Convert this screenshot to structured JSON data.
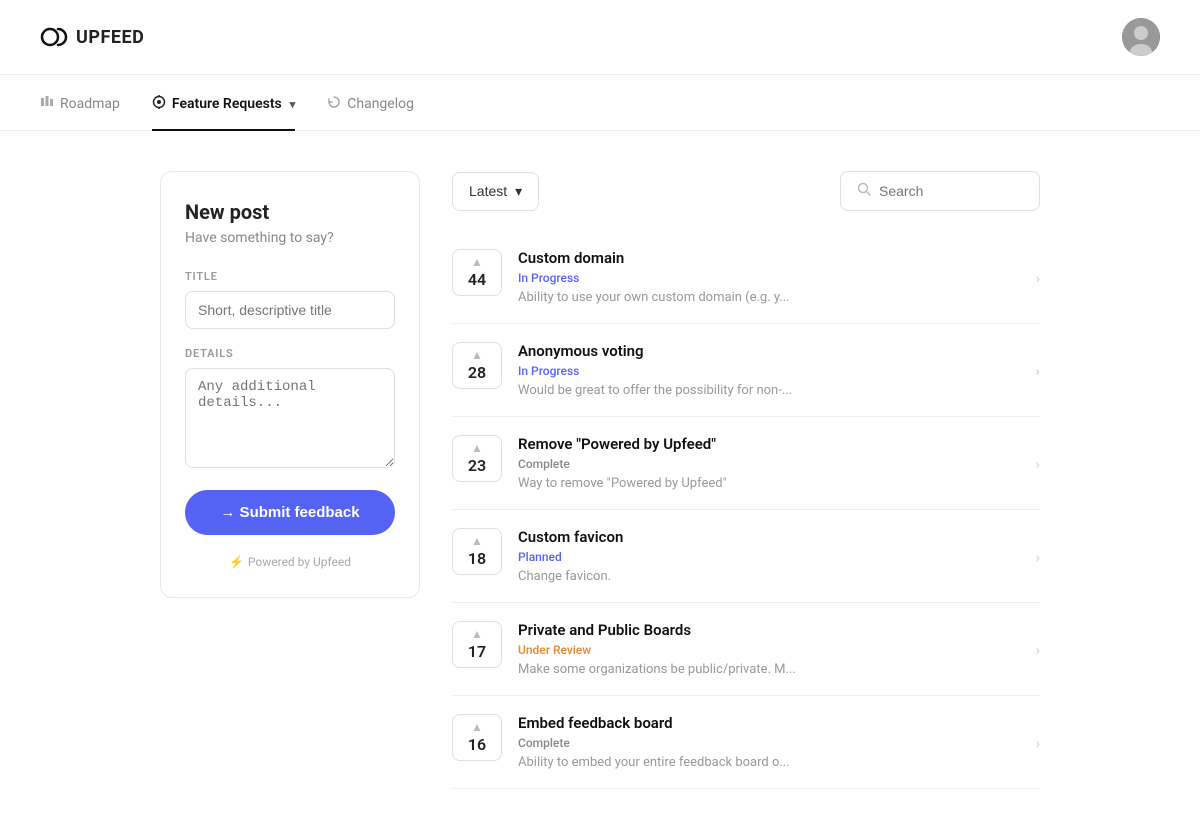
{
  "app": {
    "logo_text": "UPFEED"
  },
  "nav": {
    "items": [
      {
        "id": "roadmap",
        "label": "Roadmap",
        "icon": "📊",
        "active": false
      },
      {
        "id": "feature-requests",
        "label": "Feature Requests",
        "icon": "💡",
        "active": true,
        "has_chevron": true
      },
      {
        "id": "changelog",
        "label": "Changelog",
        "icon": "🔄",
        "active": false
      }
    ]
  },
  "new_post": {
    "title": "New post",
    "subtitle": "Have something to say?",
    "title_label": "TITLE",
    "title_placeholder": "Short, descriptive title",
    "details_label": "DETAILS",
    "details_placeholder": "Any additional details...",
    "submit_label": "→ Submit feedback",
    "powered_by": "Powered by Upfeed"
  },
  "feed": {
    "sort_label": "Latest",
    "search_placeholder": "Search",
    "items": [
      {
        "id": 1,
        "title": "Custom domain",
        "status": "In Progress",
        "status_class": "status-in-progress",
        "description": "Ability to use your own custom domain (e.g. y...",
        "votes": 44
      },
      {
        "id": 2,
        "title": "Anonymous voting",
        "status": "In Progress",
        "status_class": "status-in-progress",
        "description": "Would be great to offer the possibility for non-...",
        "votes": 28
      },
      {
        "id": 3,
        "title": "Remove \"Powered by Upfeed\"",
        "status": "Complete",
        "status_class": "status-complete",
        "description": "Way to remove \"Powered by Upfeed\"",
        "votes": 23
      },
      {
        "id": 4,
        "title": "Custom favicon",
        "status": "Planned",
        "status_class": "status-planned",
        "description": "Change favicon.",
        "votes": 18
      },
      {
        "id": 5,
        "title": "Private and Public Boards",
        "status": "Under Review",
        "status_class": "status-under-review",
        "description": "Make some organizations be public/private. M...",
        "votes": 17
      },
      {
        "id": 6,
        "title": "Embed feedback board",
        "status": "Complete",
        "status_class": "status-complete",
        "description": "Ability to embed your entire feedback board o...",
        "votes": 16
      }
    ]
  }
}
